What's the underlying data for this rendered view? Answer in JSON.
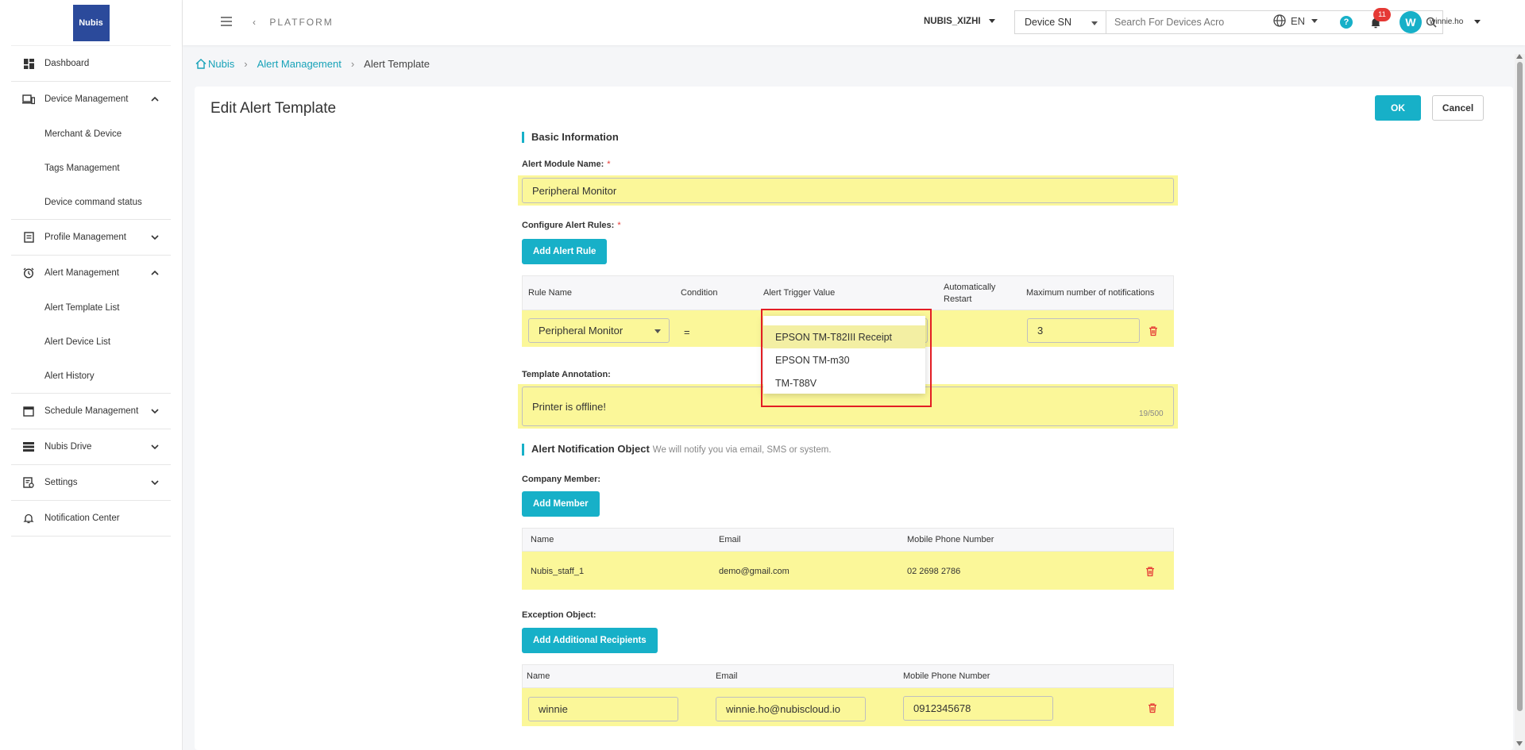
{
  "sidebar": {
    "logo_text": "Nubis",
    "groups": [
      {
        "label": "Dashboard",
        "icon": "dashboard-icon",
        "children": []
      },
      {
        "label": "Device Management",
        "icon": "devices-icon",
        "expanded": true,
        "children": [
          "Merchant & Device",
          "Tags Management",
          "Device command status"
        ]
      },
      {
        "label": "Profile Management",
        "icon": "profile-icon",
        "expanded": false,
        "children": []
      },
      {
        "label": "Alert Management",
        "icon": "alarm-icon",
        "expanded": true,
        "children": [
          "Alert Template List",
          "Alert Device List",
          "Alert History"
        ]
      },
      {
        "label": "Schedule Management",
        "icon": "calendar-icon",
        "expanded": false,
        "children": []
      },
      {
        "label": "Nubis Drive",
        "icon": "drive-icon",
        "expanded": false,
        "children": []
      },
      {
        "label": "Settings",
        "icon": "settings-icon",
        "expanded": false,
        "children": []
      },
      {
        "label": "Notification Center",
        "icon": "bell-icon",
        "children": []
      }
    ]
  },
  "header": {
    "platform": "PLATFORM",
    "org": "NUBIS_XIZHI",
    "search_type": "Device SN",
    "search_placeholder": "Search For Devices Acro",
    "lang": "EN",
    "help": "?",
    "notifications": "11",
    "avatar_letter": "W",
    "username": "winnie.ho"
  },
  "breadcrumb": [
    "Nubis",
    "Alert Management",
    "Alert Template"
  ],
  "page": {
    "title": "Edit Alert Template",
    "ok": "OK",
    "cancel": "Cancel"
  },
  "basic": {
    "section": "Basic Information",
    "module_name_label": "Alert Module Name:",
    "module_name_value": "Peripheral Monitor",
    "rules_label": "Configure Alert Rules:",
    "add_rule": "Add Alert Rule",
    "rules_columns": [
      "Rule Name",
      "Condition",
      "Alert Trigger Value",
      "Automatically Restart",
      "Maximum number of notifications"
    ],
    "rule": {
      "name": "Peripheral Monitor",
      "condition": "=",
      "max_notifications": "3"
    },
    "trigger_options": [
      "EPSON TM-T82III Receipt",
      "EPSON TM-m30",
      "TM-T88V"
    ],
    "annotation_label": "Template Annotation:",
    "annotation_value": "Printer is offline!",
    "annotation_counter": "19/500"
  },
  "notify": {
    "section": "Alert Notification Object",
    "hint": "We will notify you via email, SMS or system.",
    "company_label": "Company Member:",
    "add_member": "Add Member",
    "member_columns": [
      "Name",
      "Email",
      "Mobile Phone Number"
    ],
    "member": {
      "name": "Nubis_staff_1",
      "email": "demo@gmail.com",
      "phone": "02 2698 2786"
    },
    "exception_label": "Exception Object:",
    "add_recipients": "Add Additional Recipients",
    "recipient_columns": [
      "Name",
      "Email",
      "Mobile Phone Number"
    ],
    "recipient": {
      "name": "winnie",
      "email": "winnie.ho@nubiscloud.io",
      "phone": "0912345678"
    }
  },
  "colors": {
    "accent": "#17b0c8",
    "highlight": "#fbf799",
    "danger": "#e53935"
  }
}
